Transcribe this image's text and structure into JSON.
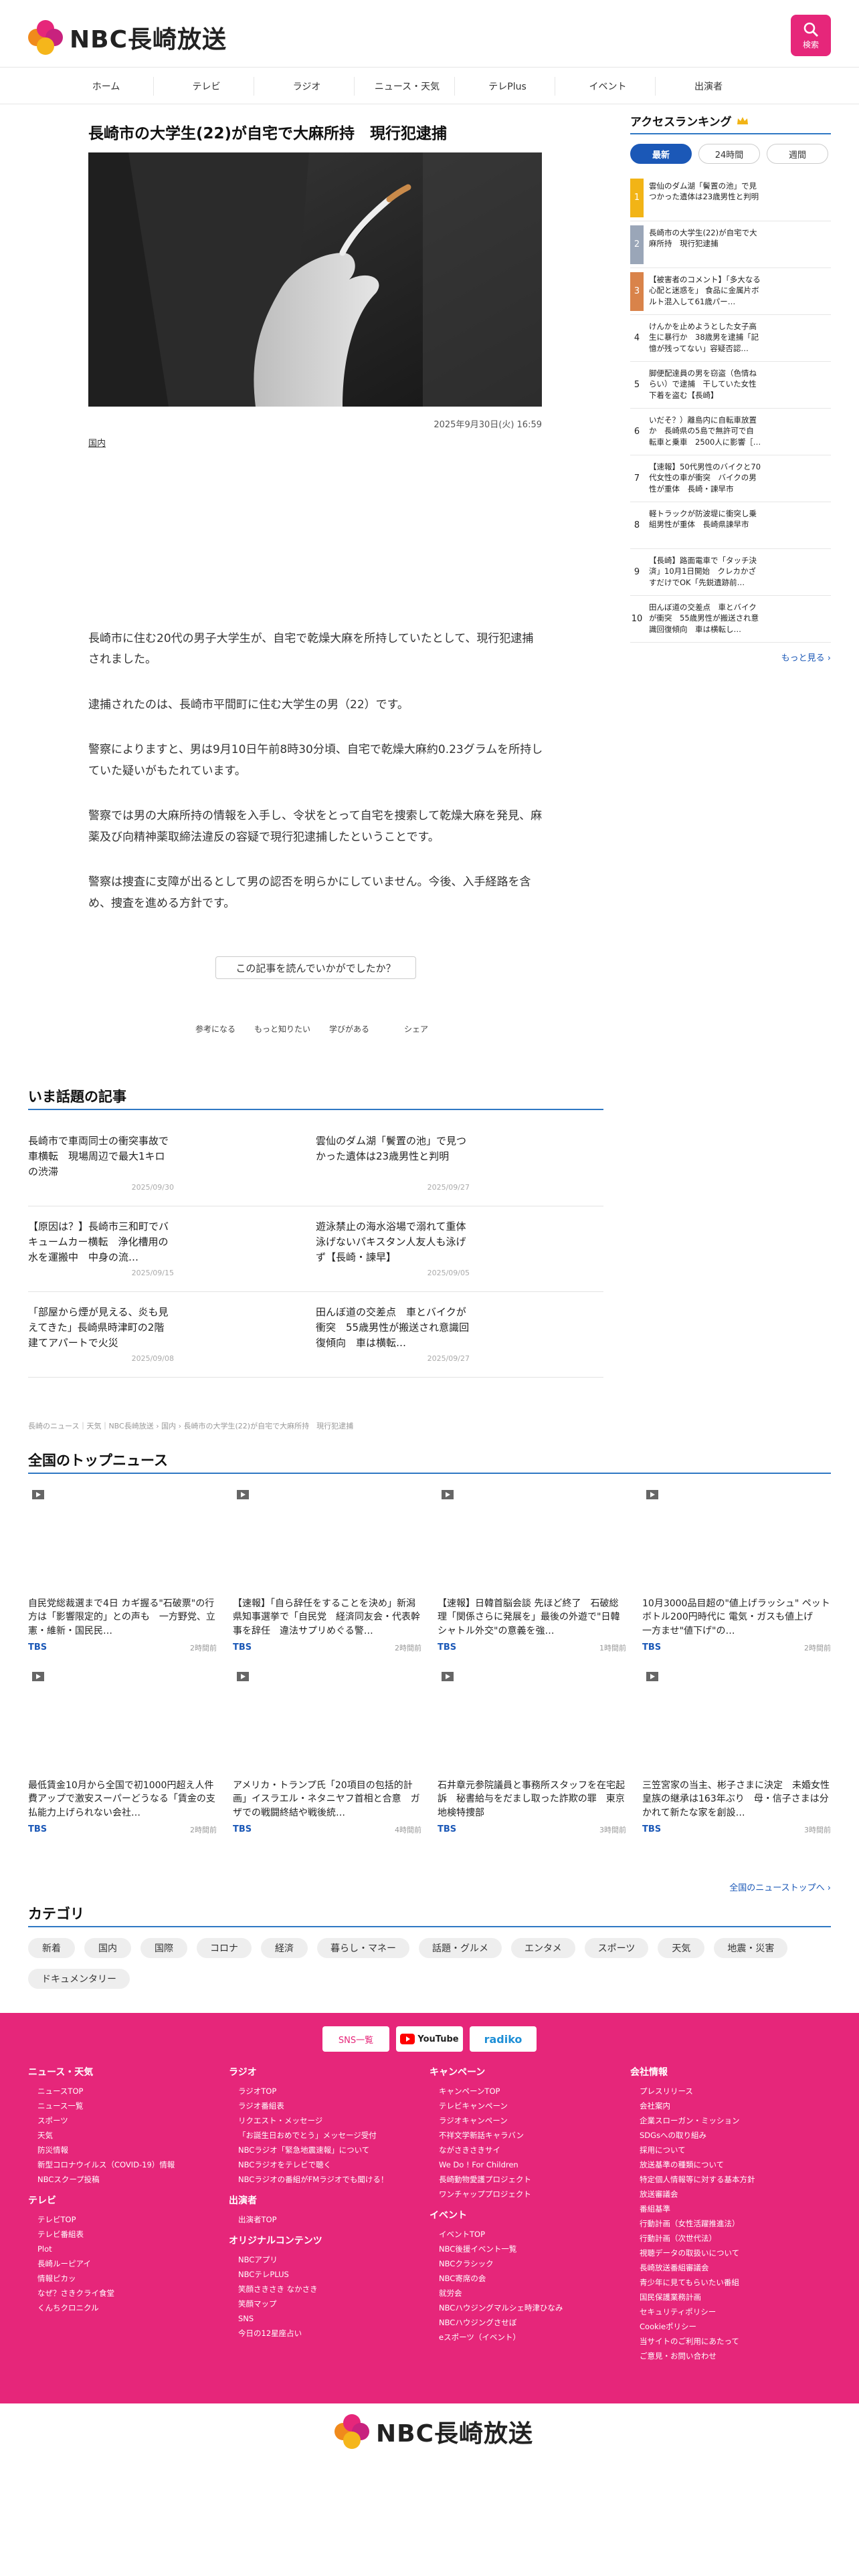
{
  "brand": {
    "name": "NBC長崎放送",
    "accent": "#e6267a",
    "link_color": "#1b58b7",
    "rule_color": "#2f78c4"
  },
  "header": {
    "search_label": "検索"
  },
  "nav": [
    {
      "label": "ホーム",
      "icon": "home-icon"
    },
    {
      "label": "テレビ",
      "icon": "tv-icon"
    },
    {
      "label": "ラジオ",
      "icon": "radio-icon"
    },
    {
      "label": "ニュース・天気",
      "icon": "news-icon"
    },
    {
      "label": "テレPlus",
      "icon": "play-icon"
    },
    {
      "label": "イベント",
      "icon": "calendar-icon"
    },
    {
      "label": "出演者",
      "icon": "people-icon"
    }
  ],
  "article": {
    "title": "長崎市の大学生(22)が自宅で大麻所持　現行犯逮捕",
    "date": "2025年9月30日(火) 16:59",
    "category": "国内",
    "paragraphs": [
      "長崎市に住む20代の男子大学生が、自宅で乾燥大麻を所持していたとして、現行犯逮捕されました。",
      "逮捕されたのは、長崎市平間町に住む大学生の男（22）です。",
      "警察によりますと、男は9月10日午前8時30分頃、自宅で乾燥大麻約0.23グラムを所持していた疑いがもたれています。",
      "警察では男の大麻所持の情報を入手し、令状をとって自宅を捜索して乾燥大麻を発見、麻薬及び向精神薬取締法違反の容疑で現行犯逮捕したということです。",
      "警察は捜査に支障が出るとして男の認否を明らかにしていません。今後、入手経路を含め、捜査を進める方針です。"
    ]
  },
  "survey": {
    "question": "この記事を読んでいかがでしたか？",
    "options": [
      {
        "label": "参考になる",
        "icon": "lightbulb-icon"
      },
      {
        "label": "もっと知りたい",
        "icon": "search-icon"
      },
      {
        "label": "学びがある",
        "icon": "book-icon"
      },
      {
        "label": "シェア",
        "icon": "share-icon"
      }
    ]
  },
  "trending": {
    "heading": "いま話題の記事",
    "items": [
      {
        "title": "長崎市で車両同士の衝突事故で車横転　現場周辺で最大1キロの渋滞",
        "date": "2025/09/30"
      },
      {
        "title": "雲仙のダム湖「鬢置の池」で見つかった遺体は23歳男性と判明",
        "date": "2025/09/27"
      },
      {
        "title": "【原因は？】長崎市三和町でバキュームカー横転　浄化槽用の水を運搬中　中身の流…",
        "date": "2025/09/15"
      },
      {
        "title": "遊泳禁止の海水浴場で溺れて重体　泳げないパキスタン人友人も泳げず【長崎・諫早】",
        "date": "2025/09/05"
      },
      {
        "title": "「部屋から煙が見える、炎も見えてきた」長崎県時津町の2階建てアパートで火災",
        "date": "2025/09/08"
      },
      {
        "title": "田んぼ道の交差点　車とバイクが衝突　55歳男性が搬送され意識回復傾向　車は横転…",
        "date": "2025/09/27"
      }
    ]
  },
  "breadcrumb": "長崎のニュース｜天気｜NBC長崎放送 › 国内 › 長崎市の大学生(22)が自宅で大麻所持　現行犯逮捕",
  "national": {
    "heading": "全国のトップニュース",
    "more": "全国のニューストップへ",
    "items": [
      {
        "title": "自民党総裁選まで4日 カギ握る\"石破票\"の行方は「影響限定的」との声も　一方野党、立憲・維新・国民民…",
        "source": "TBS",
        "time": "2時間前"
      },
      {
        "title": "【速報】「自ら辞任をすることを決め」新潟県知事選挙で「自民党　経済同友会・代表幹事を辞任　違法サプリめぐる警…",
        "source": "TBS",
        "time": "2時間前"
      },
      {
        "title": "【速報】日韓首脳会談 先ほど終了　石破総理「関係さらに発展を」最後の外遊で\"日韓シャトル外交\"の意義を強…",
        "source": "TBS",
        "time": "1時間前"
      },
      {
        "title": "10月3000品目超の\"値上げラッシュ\" ペットボトル200円時代に 電気・ガスも値上げ　一方ませ\"値下げ\"の…",
        "source": "TBS",
        "time": "2時間前"
      },
      {
        "title": "最低賃金10月から全国で初1000円超え人件費アップで激安スーパーどうなる「賃金の支払能力上げられない会社…",
        "source": "TBS",
        "time": "2時間前"
      },
      {
        "title": "アメリカ・トランプ氏「20項目の包括的計画」イスラエル・ネタニヤフ首相と合意　ガザでの戦闘終結や戦後統…",
        "source": "TBS",
        "time": "4時間前"
      },
      {
        "title": "石井章元参院議員と事務所スタッフを在宅起訴　秘書給与をだまし取った詐欺の罪　東京地検特捜部",
        "source": "TBS",
        "time": "3時間前"
      },
      {
        "title": "三笠宮家の当主、彬子さまに決定　未婚女性皇族の継承は163年ぶり　母・信子さまは分かれて新たな家を創設…",
        "source": "TBS",
        "time": "3時間前"
      }
    ]
  },
  "categories": {
    "heading": "カテゴリ",
    "items": [
      "新着",
      "国内",
      "国際",
      "コロナ",
      "経済",
      "暮らし・マネー",
      "話題・グルメ",
      "エンタメ",
      "スポーツ",
      "天気",
      "地震・災害",
      "ドキュメンタリー"
    ]
  },
  "ranking": {
    "heading": "アクセスランキング",
    "tabs": [
      "最新",
      "24時間",
      "週間"
    ],
    "more": "もっと見る",
    "items": [
      "雲仙のダム湖「鬢置の池」で見つかった遺体は23歳男性と判明",
      "長崎市の大学生(22)が自宅で大麻所持　現行犯逮捕",
      "【被害者のコメント】「多大なる心配と迷惑を」 食品に金属片ボルト混入して61歳パー…",
      "けんかを止めようとした女子高生に暴行か　38歳男を逮捕「記憶が残ってない」容疑否認…",
      "脚便配達員の男を窃盗（色情ねらい）で逮捕　干していた女性下着を盗む【長崎】",
      "いだそ？）離島内に自転車放置か　長崎県の5島で無許可で自転車と乗車　2500人に影響［…",
      "【速報】50代男性のバイクと70代女性の車が衝突　バイクの男性が重体　長崎・諫早市",
      "軽トラックが防波堤に衝突し乗組男性が重体　長崎県諫早市",
      "【長崎】路面電車で「タッチ決済」10月1日開始　クレカかざすだけでOK「先鋭遺跡前…",
      "田んぼ道の交差点　車とバイクが衝突　55歳男性が搬送され意識回復傾向　車は横転し…"
    ]
  },
  "footer": {
    "sns": [
      "SNS一覧",
      "YouTube",
      "radiko"
    ],
    "columns": [
      {
        "groups": [
          {
            "heading": "ニュース・天気",
            "links": [
              "ニュースTOP",
              "ニュース一覧",
              "スポーツ",
              "天気",
              "防災情報",
              "新型コロナウイルス（COVID-19）情報",
              "NBCスクープ投稿"
            ]
          },
          {
            "heading": "テレビ",
            "links": [
              "テレビTOP",
              "テレビ番組表",
              "Plot",
              "長崎ルーピアイ",
              "情報ピカッ",
              "なぜ？さきクライ食堂",
              "くんちクロニクル"
            ]
          }
        ]
      },
      {
        "groups": [
          {
            "heading": "ラジオ",
            "links": [
              "ラジオTOP",
              "ラジオ番組表",
              "リクエスト・メッセージ",
              "「お誕生日おめでとう」メッセージ受付",
              "NBCラジオ「緊急地震速報」について",
              "NBCラジオをテレビで聴く",
              "NBCラジオの番組がFMラジオでも聞ける！"
            ]
          },
          {
            "heading": "出演者",
            "links": [
              "出演者TOP"
            ]
          },
          {
            "heading": "オリジナルコンテンツ",
            "links": [
              "NBCアプリ",
              "NBCテレPLUS",
              "笑顔さきさき なかさき",
              "笑顔マップ",
              "SNS",
              "今日の12星座占い"
            ]
          }
        ]
      },
      {
        "groups": [
          {
            "heading": "キャンペーン",
            "links": [
              "キャンペーンTOP",
              "テレビキャンペーン",
              "ラジオキャンペーン",
              "不祥文学新話キャラバン",
              "ながさきさきサイ",
              "We Do ! For Children",
              "長崎動物愛護プロジェクト",
              "ワンチャッププロジェクト"
            ]
          },
          {
            "heading": "イベント",
            "links": [
              "イベントTOP",
              "NBC後援イベント一覧",
              "NBCクラシック",
              "NBC寄席の会",
              "就労会",
              "NBCハウジングマルシェ時津ひなみ",
              "NBCハウジングさせぼ",
              "eスポーツ（イベント）"
            ]
          }
        ]
      },
      {
        "groups": [
          {
            "heading": "会社情報",
            "links": [
              "プレスリリース",
              "会社案内",
              "企業スローガン・ミッション",
              "SDGsへの取り組み",
              "採用について",
              "放送基準の種類について",
              "特定個人情報等に対する基本方針",
              "放送審議会",
              "番組基準",
              "行動計画（女性活躍推進法）",
              "行動計画（次世代法）",
              "視聴データの取扱いについて",
              "長崎放送番組審議会",
              "青少年に見てもらいたい番組",
              "国民保護業務計画",
              "セキュリティポリシー",
              "Cookieポリシー",
              "当サイトのご利用にあたって",
              "ご意見・お問い合わせ"
            ]
          }
        ]
      }
    ]
  }
}
